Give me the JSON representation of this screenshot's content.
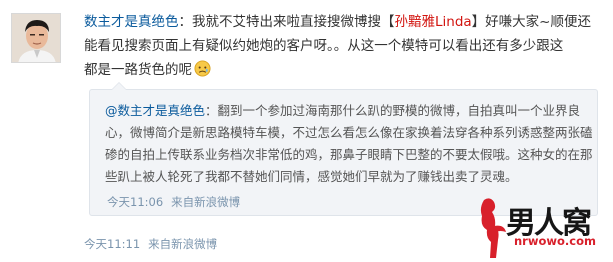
{
  "post": {
    "author": "数主才是真绝色",
    "line1_text": "：我就不艾特出来啦直接搜微博搜【",
    "mention_name": "孙黯雅Linda",
    "line1_rest": "】好嗛大家~顺便还",
    "line2": "能看见搜索页面上有疑似约她炮的客户呀。。从这一个模特可以看出还有多少跟这",
    "line3": "都是一路货色的呢",
    "emoji_icon": "sad-face-emoji",
    "time": "今天11:11",
    "source": "来自新浪微博"
  },
  "quote": {
    "author": "@数主才是真绝色",
    "line1": "：翻到一个参加过海南那什么趴的野模的微博，自拍真叫一个业界良",
    "line2": "心，微博简介是新思路模特车模，不过怎么看怎么像在家换着法穿各种系列诱惑整两张磕",
    "line3": "碜的自拍上传联系业务档次非常低的鸡，那鼻子眼睛下巴整的不要太假哦。这种女的在那",
    "line4": "些趴上被人轮死了我都不替她们同情，感觉她们早就为了赚钱出卖了灵魂。",
    "time": "今天11:06",
    "source": "来自新浪微博"
  },
  "watermark": {
    "brand": "男人窝",
    "url": "nrwowo.com"
  },
  "colors": {
    "link_blue": "#0a5a9c",
    "highlight_red": "#d2140f",
    "meta_gray_blue": "#7a94ad",
    "quote_bg": "#f2f4f7"
  }
}
